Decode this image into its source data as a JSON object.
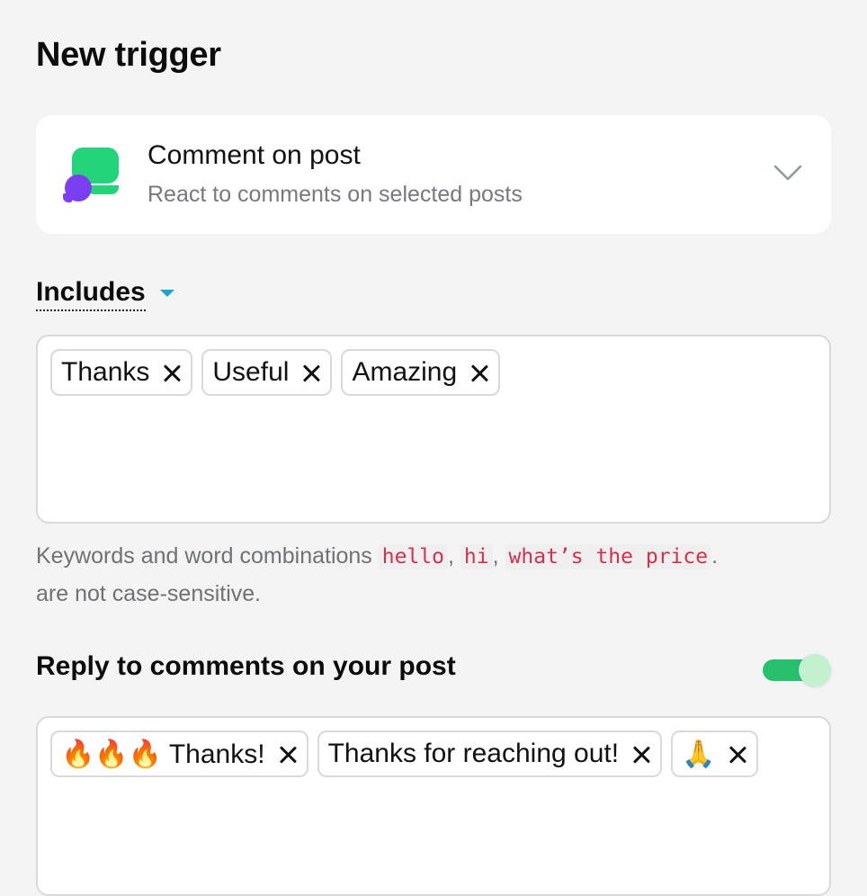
{
  "page": {
    "title": "New trigger"
  },
  "trigger": {
    "name": "Comment on post",
    "description": "React to comments on selected posts",
    "icon": "comment-bubbles-icon",
    "expand_icon": "chevron-down-icon"
  },
  "includes": {
    "label": "Includes",
    "tags": [
      "Thanks",
      "Useful",
      "Amazing"
    ],
    "hint": {
      "prefix": "Keywords and word combinations",
      "examples": [
        "hello",
        "hi",
        "what’s the price"
      ],
      "suffix": "are not case-sensitive."
    }
  },
  "reply": {
    "label": "Reply to comments on your post",
    "toggle_on": true,
    "tags": [
      "🔥🔥🔥 Thanks!",
      "Thanks for reaching out!",
      "🙏"
    ]
  },
  "colors": {
    "accent_green": "#28c06c",
    "icon_green": "#23d47a",
    "icon_purple": "#7b3ff2",
    "caret_blue": "#1aa6c9",
    "code_red": "#d6304f"
  }
}
